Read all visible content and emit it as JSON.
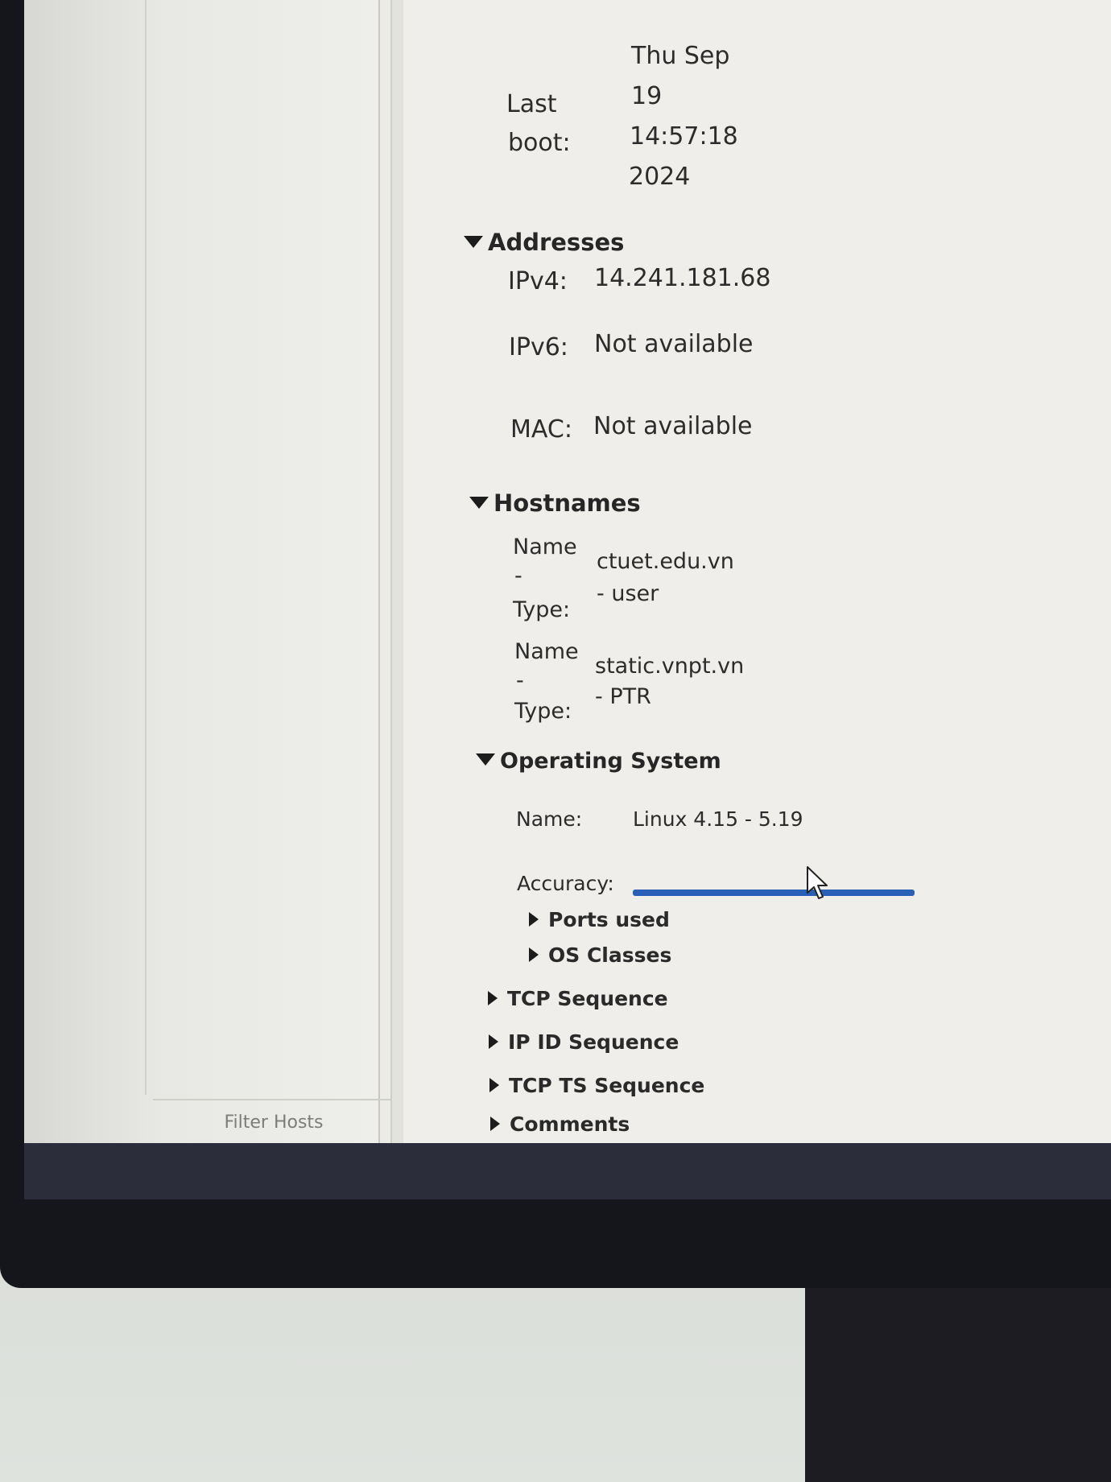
{
  "host_list": {
    "filter_placeholder": "Filter Hosts"
  },
  "details": {
    "last_boot": {
      "label_line1": "Last",
      "label_line2": "boot:",
      "value_line1": "Thu Sep",
      "value_line2": "19",
      "value_line3": "14:57:18",
      "value_line4": "2024"
    },
    "addresses": {
      "header": "Addresses",
      "ipv4_label": "IPv4:",
      "ipv4_value": "14.241.181.68",
      "ipv6_label": "IPv6:",
      "ipv6_value": "Not available",
      "mac_label": "MAC:",
      "mac_value": "Not available"
    },
    "hostnames": {
      "header": "Hostnames",
      "entries": [
        {
          "label_name": "Name",
          "label_dash": "-",
          "label_type": "Type:",
          "value_name": "ctuet.edu.vn",
          "value_type": "- user"
        },
        {
          "label_name": "Name",
          "label_dash": "-",
          "label_type": "Type:",
          "value_name": "static.vnpt.vn",
          "value_type": "- PTR"
        }
      ]
    },
    "operating_system": {
      "header": "Operating System",
      "name_label": "Name:",
      "name_value": "Linux 4.15 - 5.19",
      "accuracy_label": "Accuracy:",
      "accuracy_fraction": 1.0,
      "accuracy_color": "#2a5fb8",
      "ports_used": "Ports used",
      "os_classes": "OS Classes"
    },
    "collapsed_sections": {
      "tcp_sequence": "TCP Sequence",
      "ip_id_sequence": "IP ID Sequence",
      "tcp_ts_sequence": "TCP TS Sequence",
      "comments": "Comments"
    }
  }
}
